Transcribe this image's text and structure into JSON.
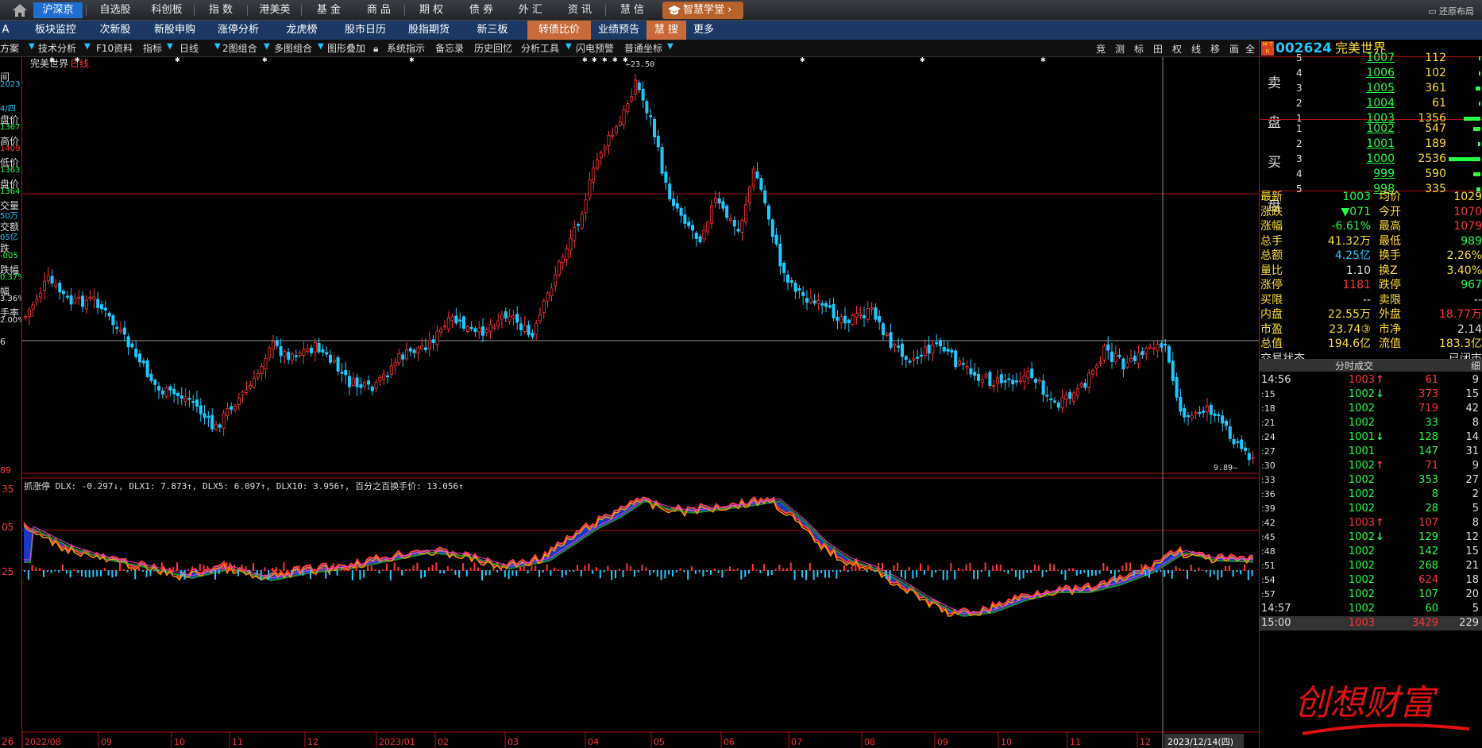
{
  "topbar": {
    "tabs": [
      "沪深京",
      "自选股",
      "科创板",
      "指 数",
      "港美英",
      "基 金",
      "商 品",
      "期 权",
      "债 券",
      "外 汇",
      "资 讯",
      "慧 信"
    ],
    "school": "智慧学堂",
    "restore": "还原布局"
  },
  "secbar": {
    "items": [
      "板块监控",
      "次新股",
      "新股申购",
      "涨停分析",
      "龙虎榜",
      "股市日历",
      "股指期货",
      "新三板",
      "转债比价",
      "业绩预告",
      "慧 搜",
      "更多"
    ],
    "left_cut": "A"
  },
  "toolbar": {
    "items": [
      "方案",
      "技术分析",
      "F10资料",
      "指标",
      "日线",
      "2图组合",
      "多图组合",
      "图形叠加",
      "系统指示",
      "备忘录",
      "历史回忆",
      "分析工具",
      "闪电预警",
      "普通坐标"
    ],
    "right_icons": [
      "竞",
      "测",
      "标",
      "田",
      "权",
      "线",
      "移",
      "画",
      "全"
    ]
  },
  "chart_header": {
    "title": "完美世界",
    "period": "日线",
    "high_label": "23.50",
    "low_label": "9.89",
    "left_price_top": "6",
    "left_price_bottom": "89"
  },
  "indicator": {
    "header": "抓涨停 DLX: -0.297↓, DLX1: 7.873↑, DLX5: 6.097↑, DLX10: 3.956↑, 百分之百换手价: 13.056↑",
    "axis_labels": [
      "35",
      "05",
      "25",
      "26"
    ]
  },
  "date_axis": [
    "2022/08",
    "09",
    "10",
    "11",
    "12",
    "2023/01",
    "02",
    "03",
    "04",
    "05",
    "06",
    "07",
    "08",
    "09",
    "10",
    "11",
    "12"
  ],
  "date_cursor": "2023/12/14(四)",
  "left_info": [
    {
      "label": "间",
      "value": "2023"
    },
    {
      "label": "",
      "value": "4/四"
    },
    {
      "label": "盘价",
      "value": "1367"
    },
    {
      "label": "高价",
      "value": "1409"
    },
    {
      "label": "低价",
      "value": "1363"
    },
    {
      "label": "盘价",
      "value": "1364"
    },
    {
      "label": "交量",
      "value": "50万"
    },
    {
      "label": "交额",
      "value": "05亿"
    },
    {
      "label": "跌",
      "value": "-005"
    },
    {
      "label": "跌幅",
      "value": "0.37%"
    },
    {
      "label": "幅",
      "value": "3.36%"
    },
    {
      "label": "手率",
      "value": "2.00%"
    }
  ],
  "quote": {
    "code": "002624",
    "name": "完美世界",
    "mtr": "M T R",
    "sell_label_1": "卖",
    "sell_label_2": "盘",
    "buy_label_1": "买",
    "buy_label_2": "盘",
    "sell": [
      {
        "level": "5",
        "price": "1007",
        "volume": "112"
      },
      {
        "level": "4",
        "price": "1006",
        "volume": "102"
      },
      {
        "level": "3",
        "price": "1005",
        "volume": "361"
      },
      {
        "level": "2",
        "price": "1004",
        "volume": "61"
      },
      {
        "level": "1",
        "price": "1003",
        "volume": "1356"
      }
    ],
    "buy": [
      {
        "level": "1",
        "price": "1002",
        "volume": "547"
      },
      {
        "level": "2",
        "price": "1001",
        "volume": "189"
      },
      {
        "level": "3",
        "price": "1000",
        "volume": "2536"
      },
      {
        "level": "4",
        "price": "999",
        "volume": "590"
      },
      {
        "level": "5",
        "price": "998",
        "volume": "335"
      }
    ],
    "stats": [
      {
        "l1": "最新",
        "v1": "1003",
        "l2": "均价",
        "v2": "1029"
      },
      {
        "l1": "涨跌",
        "v1": "▼071",
        "l2": "今开",
        "v2": "1070"
      },
      {
        "l1": "涨幅",
        "v1": "-6.61%",
        "l2": "最高",
        "v2": "1079"
      },
      {
        "l1": "总手",
        "v1": "41.32万",
        "l2": "最低",
        "v2": "989"
      },
      {
        "l1": "总额",
        "v1": "4.25亿",
        "l2": "换手",
        "v2": "2.26%"
      },
      {
        "l1": "量比",
        "v1": "1.10",
        "l2": "换Z",
        "v2": "3.40%"
      },
      {
        "l1": "涨停",
        "v1": "1181",
        "l2": "跌停",
        "v2": "967"
      },
      {
        "l1": "买限",
        "v1": "--",
        "l2": "卖限",
        "v2": "--"
      },
      {
        "l1": "内盘",
        "v1": "22.55万",
        "l2": "外盘",
        "v2": "18.77万"
      },
      {
        "l1": "市盈",
        "v1": "23.74③",
        "l2": "市净",
        "v2": "2.14"
      },
      {
        "l1": "总值",
        "v1": "194.6亿",
        "l2": "流值",
        "v2": "183.3亿"
      }
    ],
    "status_label": "交易状态",
    "status_value": "已闭市",
    "ticks_title": "分时成交",
    "ticks_right": "细",
    "ticks": [
      {
        "t": "14:56",
        "p": "1003",
        "a": "↑",
        "v": "61",
        "n": "9"
      },
      {
        "t": ":15",
        "p": "1002",
        "a": "↓",
        "v": "373",
        "n": "15"
      },
      {
        "t": ":18",
        "p": "1002",
        "a": "",
        "v": "719",
        "n": "42"
      },
      {
        "t": ":21",
        "p": "1002",
        "a": "",
        "v": "33",
        "n": "8"
      },
      {
        "t": ":24",
        "p": "1001",
        "a": "↓",
        "v": "128",
        "n": "14"
      },
      {
        "t": ":27",
        "p": "1001",
        "a": "",
        "v": "147",
        "n": "31"
      },
      {
        "t": ":30",
        "p": "1002",
        "a": "↑",
        "v": "71",
        "n": "9"
      },
      {
        "t": ":33",
        "p": "1002",
        "a": "",
        "v": "353",
        "n": "27"
      },
      {
        "t": ":36",
        "p": "1002",
        "a": "",
        "v": "8",
        "n": "2"
      },
      {
        "t": ":39",
        "p": "1002",
        "a": "",
        "v": "28",
        "n": "5"
      },
      {
        "t": ":42",
        "p": "1003",
        "a": "↑",
        "v": "107",
        "n": "8"
      },
      {
        "t": ":45",
        "p": "1002",
        "a": "↓",
        "v": "129",
        "n": "12"
      },
      {
        "t": ":48",
        "p": "1002",
        "a": "",
        "v": "142",
        "n": "15"
      },
      {
        "t": ":51",
        "p": "1002",
        "a": "",
        "v": "268",
        "n": "21"
      },
      {
        "t": ":54",
        "p": "1002",
        "a": "",
        "v": "624",
        "n": "18"
      },
      {
        "t": ":57",
        "p": "1002",
        "a": "",
        "v": "107",
        "n": "20"
      },
      {
        "t": "14:57",
        "p": "1002",
        "a": "",
        "v": "60",
        "n": "5"
      },
      {
        "t": "15:00",
        "p": "1003",
        "a": "",
        "v": "3429",
        "n": "229"
      }
    ]
  },
  "watermark": "创想财富",
  "colors": {
    "up": "#ff3333",
    "down": "#1ec9ff",
    "grid": "#aa1111",
    "price_green": "#22ff44",
    "yellow": "#ffdd33"
  }
}
